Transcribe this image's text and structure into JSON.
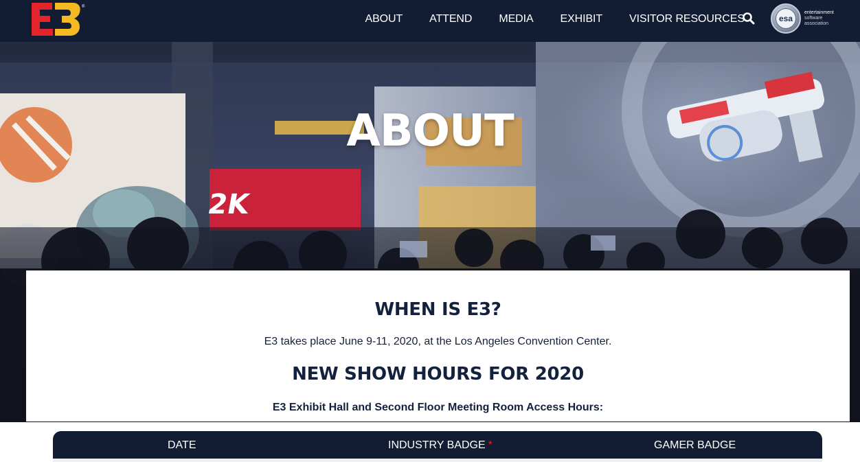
{
  "header": {
    "logo_text": "E3",
    "nav": [
      "ABOUT",
      "ATTEND",
      "MEDIA",
      "EXHIBIT",
      "VISITOR RESOURCES"
    ],
    "esa": {
      "badge": "esa",
      "line1": "entertainment",
      "line2": "software",
      "line3": "association"
    }
  },
  "hero": {
    "title": "ABOUT"
  },
  "content": {
    "when_heading": "WHEN IS E3?",
    "when_text": "E3 takes place June 9-11, 2020, at the Los Angeles Convention Center.",
    "hours_heading": "NEW SHOW HOURS FOR 2020",
    "hours_subheading": "E3 Exhibit Hall and Second Floor Meeting Room Access Hours:"
  },
  "table": {
    "columns": [
      "DATE",
      "INDUSTRY BADGE",
      "GAMER BADGE"
    ],
    "industry_marker": "*"
  },
  "colors": {
    "navy": "#121c33",
    "text": "#14213d",
    "e3_red": "#e3242b",
    "e3_yellow": "#f5b921"
  }
}
